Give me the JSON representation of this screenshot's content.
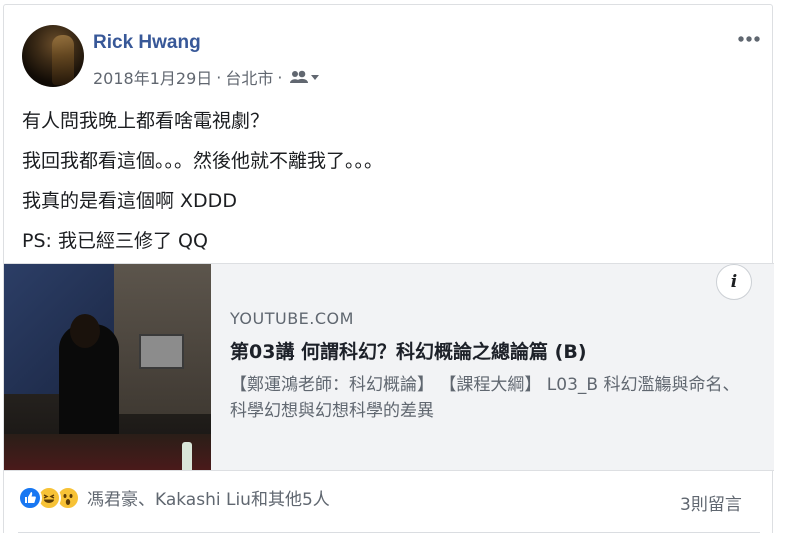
{
  "post": {
    "author": "Rick Hwang",
    "date": "2018年1月29日",
    "separator": "·",
    "location": "台北市",
    "audience_icon": "friends-icon",
    "lines": [
      "有人問我晚上都看啥電視劇？",
      "我回我都看這個。。。然後他就不離我了。。。",
      "我真的是看這個啊 XDDD",
      "PS: 我已經三修了 QQ"
    ]
  },
  "link_preview": {
    "domain": "YOUTUBE.COM",
    "title": "第03講 何謂科幻？科幻概論之總論篇 (B)",
    "description": "【鄭運鴻老師：科幻概論】 【課程大綱】 L03_B 科幻濫觴與命名、科學幻想與幻想科學的差異",
    "info_icon": "i"
  },
  "footer": {
    "reactors": "馮君豪、Kakashi Liu和其他5人",
    "comments": "3則留言",
    "reaction_icons": [
      "like-icon",
      "haha-icon",
      "wow-icon"
    ]
  },
  "colors": {
    "name": "#385898",
    "meta": "#616770",
    "like": "#1877f2",
    "emoji": "#f7c236",
    "preview_bg": "#f2f3f5"
  }
}
